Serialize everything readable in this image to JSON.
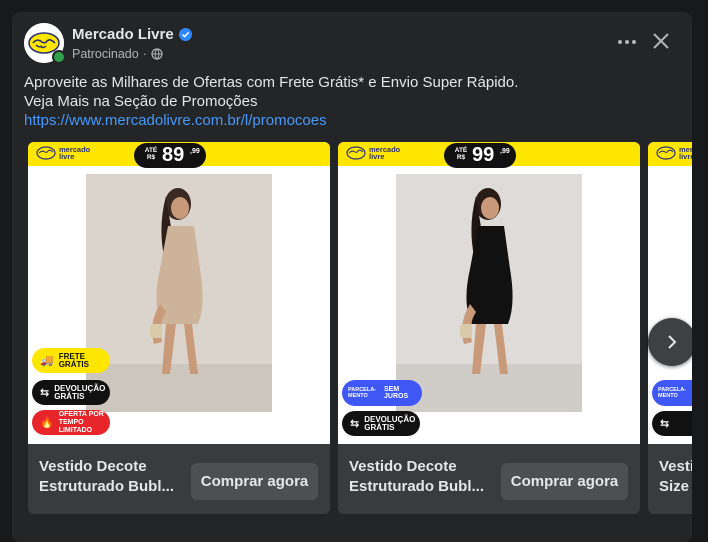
{
  "post": {
    "page_name": "Mercado Livre",
    "sponsored_label": "Patrocinado",
    "separator": "·",
    "text_line1": "Aproveite as Milhares de Ofertas com Frete Grátis* e Envio Super Rápido.",
    "text_line2": "Veja Mais na Seção de Promoções",
    "link": "https://www.mercadolivre.com.br/l/promocoes"
  },
  "icons": {
    "more": "more-horizontal-icon",
    "close": "close-icon",
    "globe": "globe-icon",
    "verified": "verified-badge-icon",
    "next": "chevron-right-icon"
  },
  "cards": [
    {
      "brand": "mercado livre",
      "price_prefix": "ATÉ R$",
      "price_main": "89",
      "price_cents": ",99",
      "badges": [
        "FRETE GRÁTIS",
        "DEVOLUÇÃO GRÁTIS",
        "OFERTA POR TEMPO LIMITADO"
      ],
      "title_line1": "Vestido Decote",
      "title_line2": "Estruturado Bubl...",
      "cta": "Comprar agora",
      "dress_color": "#cdb39a"
    },
    {
      "brand": "mercado livre",
      "price_prefix": "ATÉ R$",
      "price_main": "99",
      "price_cents": ",99",
      "badges": [
        "PARCELA- MENTO",
        "SEM JUROS",
        "DEVOLUÇÃO GRÁTIS"
      ],
      "title_line1": "Vestido Decote",
      "title_line2": "Estruturado Bubl...",
      "cta": "Comprar agora",
      "dress_color": "#111111"
    },
    {
      "brand": "mercado livre",
      "badges": [
        "PARCELA- MENTO"
      ],
      "title_line1": "Vesti",
      "title_line2": "Size I"
    }
  ],
  "colors": {
    "brand_yellow": "#ffe600",
    "brand_navy": "#2d3277",
    "link_blue": "#4599ff",
    "offer_red": "#e8252a",
    "installment_blue": "#3f58f5"
  }
}
